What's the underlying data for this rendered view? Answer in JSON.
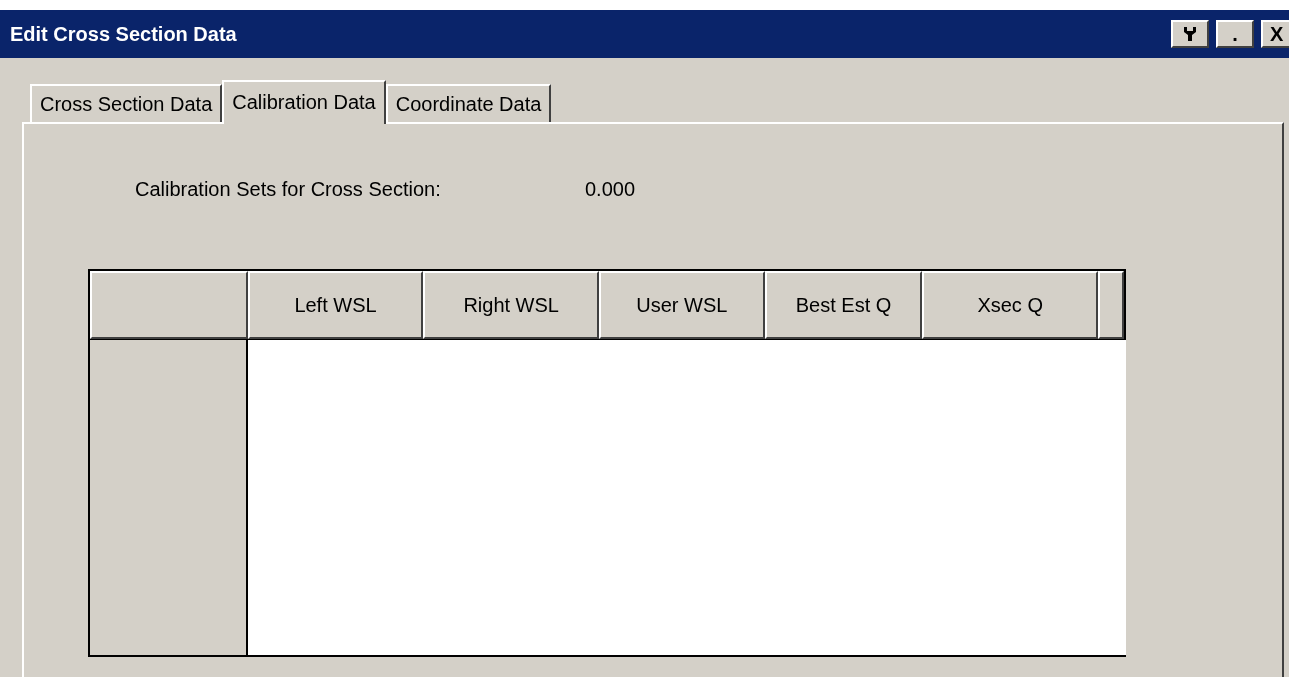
{
  "window": {
    "title": "Edit Cross Section Data",
    "buttons": [
      {
        "kind": "wrench"
      },
      {
        "kind": "text",
        "label": "."
      },
      {
        "kind": "text",
        "label": "X"
      }
    ]
  },
  "tabs": [
    {
      "label": "Cross Section Data",
      "selected": false
    },
    {
      "label": "Calibration Data",
      "selected": true
    },
    {
      "label": "Coordinate Data",
      "selected": false
    }
  ],
  "calibration": {
    "label": "Calibration Sets for Cross Section:",
    "value": "0.000"
  },
  "table": {
    "columns": [
      "Left WSL",
      "Right WSL",
      "User WSL",
      "Best Est Q",
      "Xsec Q"
    ]
  }
}
